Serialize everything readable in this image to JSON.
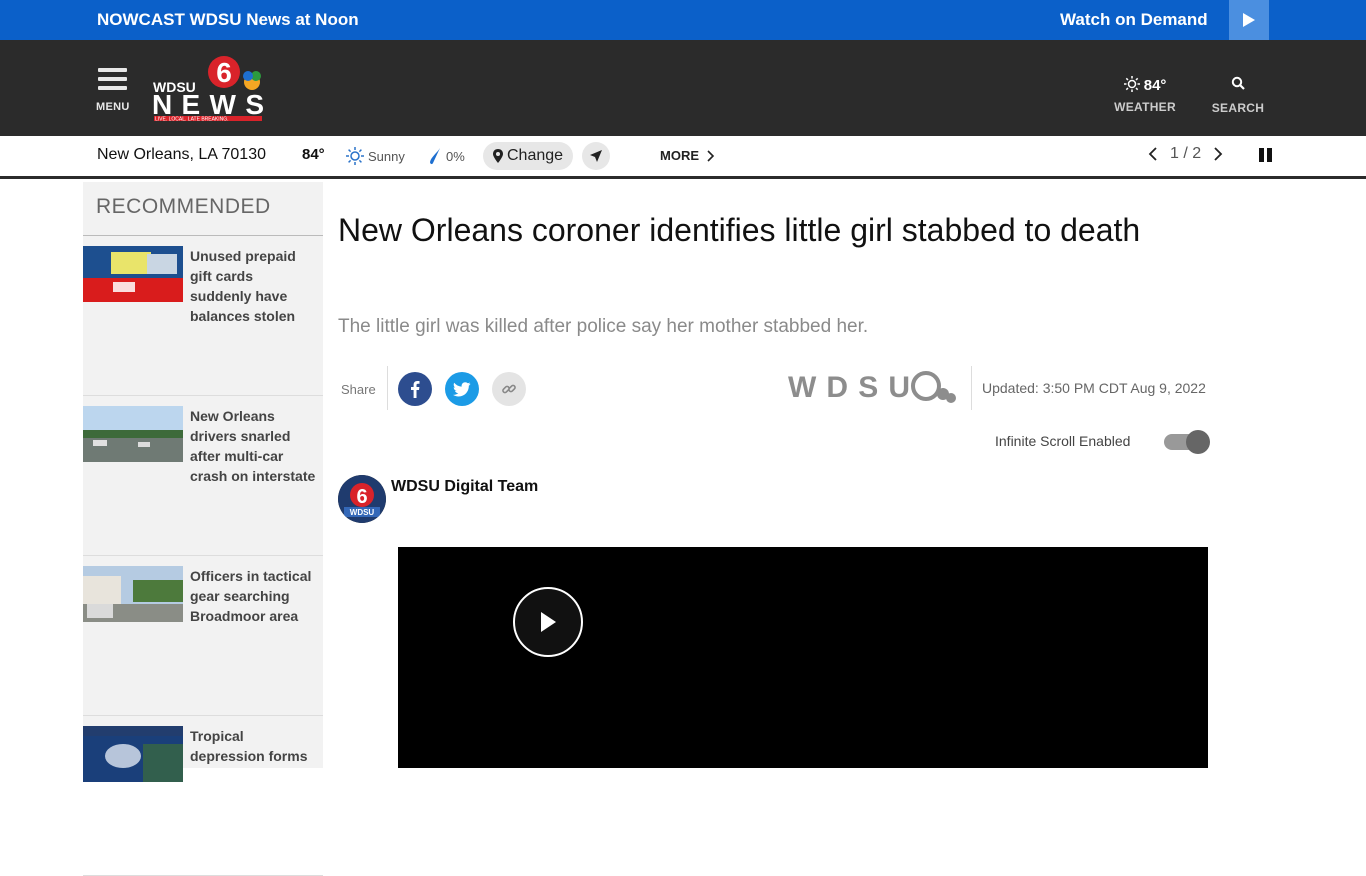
{
  "topbar": {
    "live_label": "NOWCAST WDSU News at Noon",
    "on_demand_label": "Watch on Demand",
    "color": "#0b60c9"
  },
  "header": {
    "menu_label": "MENU",
    "logo_text": "WDSU NEWS",
    "logo_tagline": "LIVE. LOCAL. LATE BREAKING.",
    "weather_temp": "84°",
    "weather_label": "WEATHER",
    "search_label": "SEARCH"
  },
  "weather_strip": {
    "location": "New Orleans, LA 70130",
    "temp": "84°",
    "condition": "Sunny",
    "precip": "0%",
    "change_label": "Change",
    "more_label": "MORE",
    "pager_text": "1 / 2"
  },
  "sidebar": {
    "heading": "RECOMMENDED",
    "items": [
      {
        "title": "Unused prepaid gift cards suddenly have balances stolen"
      },
      {
        "title": "New Orleans drivers snarled after multi-car crash on interstate"
      },
      {
        "title": "Officers in tactical gear searching Broadmoor area"
      },
      {
        "title": "Tropical depression forms"
      }
    ]
  },
  "article": {
    "headline": "New Orleans coroner identifies little girl stabbed to death",
    "dek": "The little girl was killed after police say her mother stabbed her.",
    "share_label": "Share",
    "updated": "Updated: 3:50 PM CDT Aug 9, 2022",
    "infinite_scroll_label": "Infinite Scroll Enabled",
    "author": "WDSU Digital Team",
    "brand_mark": "WDSU"
  }
}
